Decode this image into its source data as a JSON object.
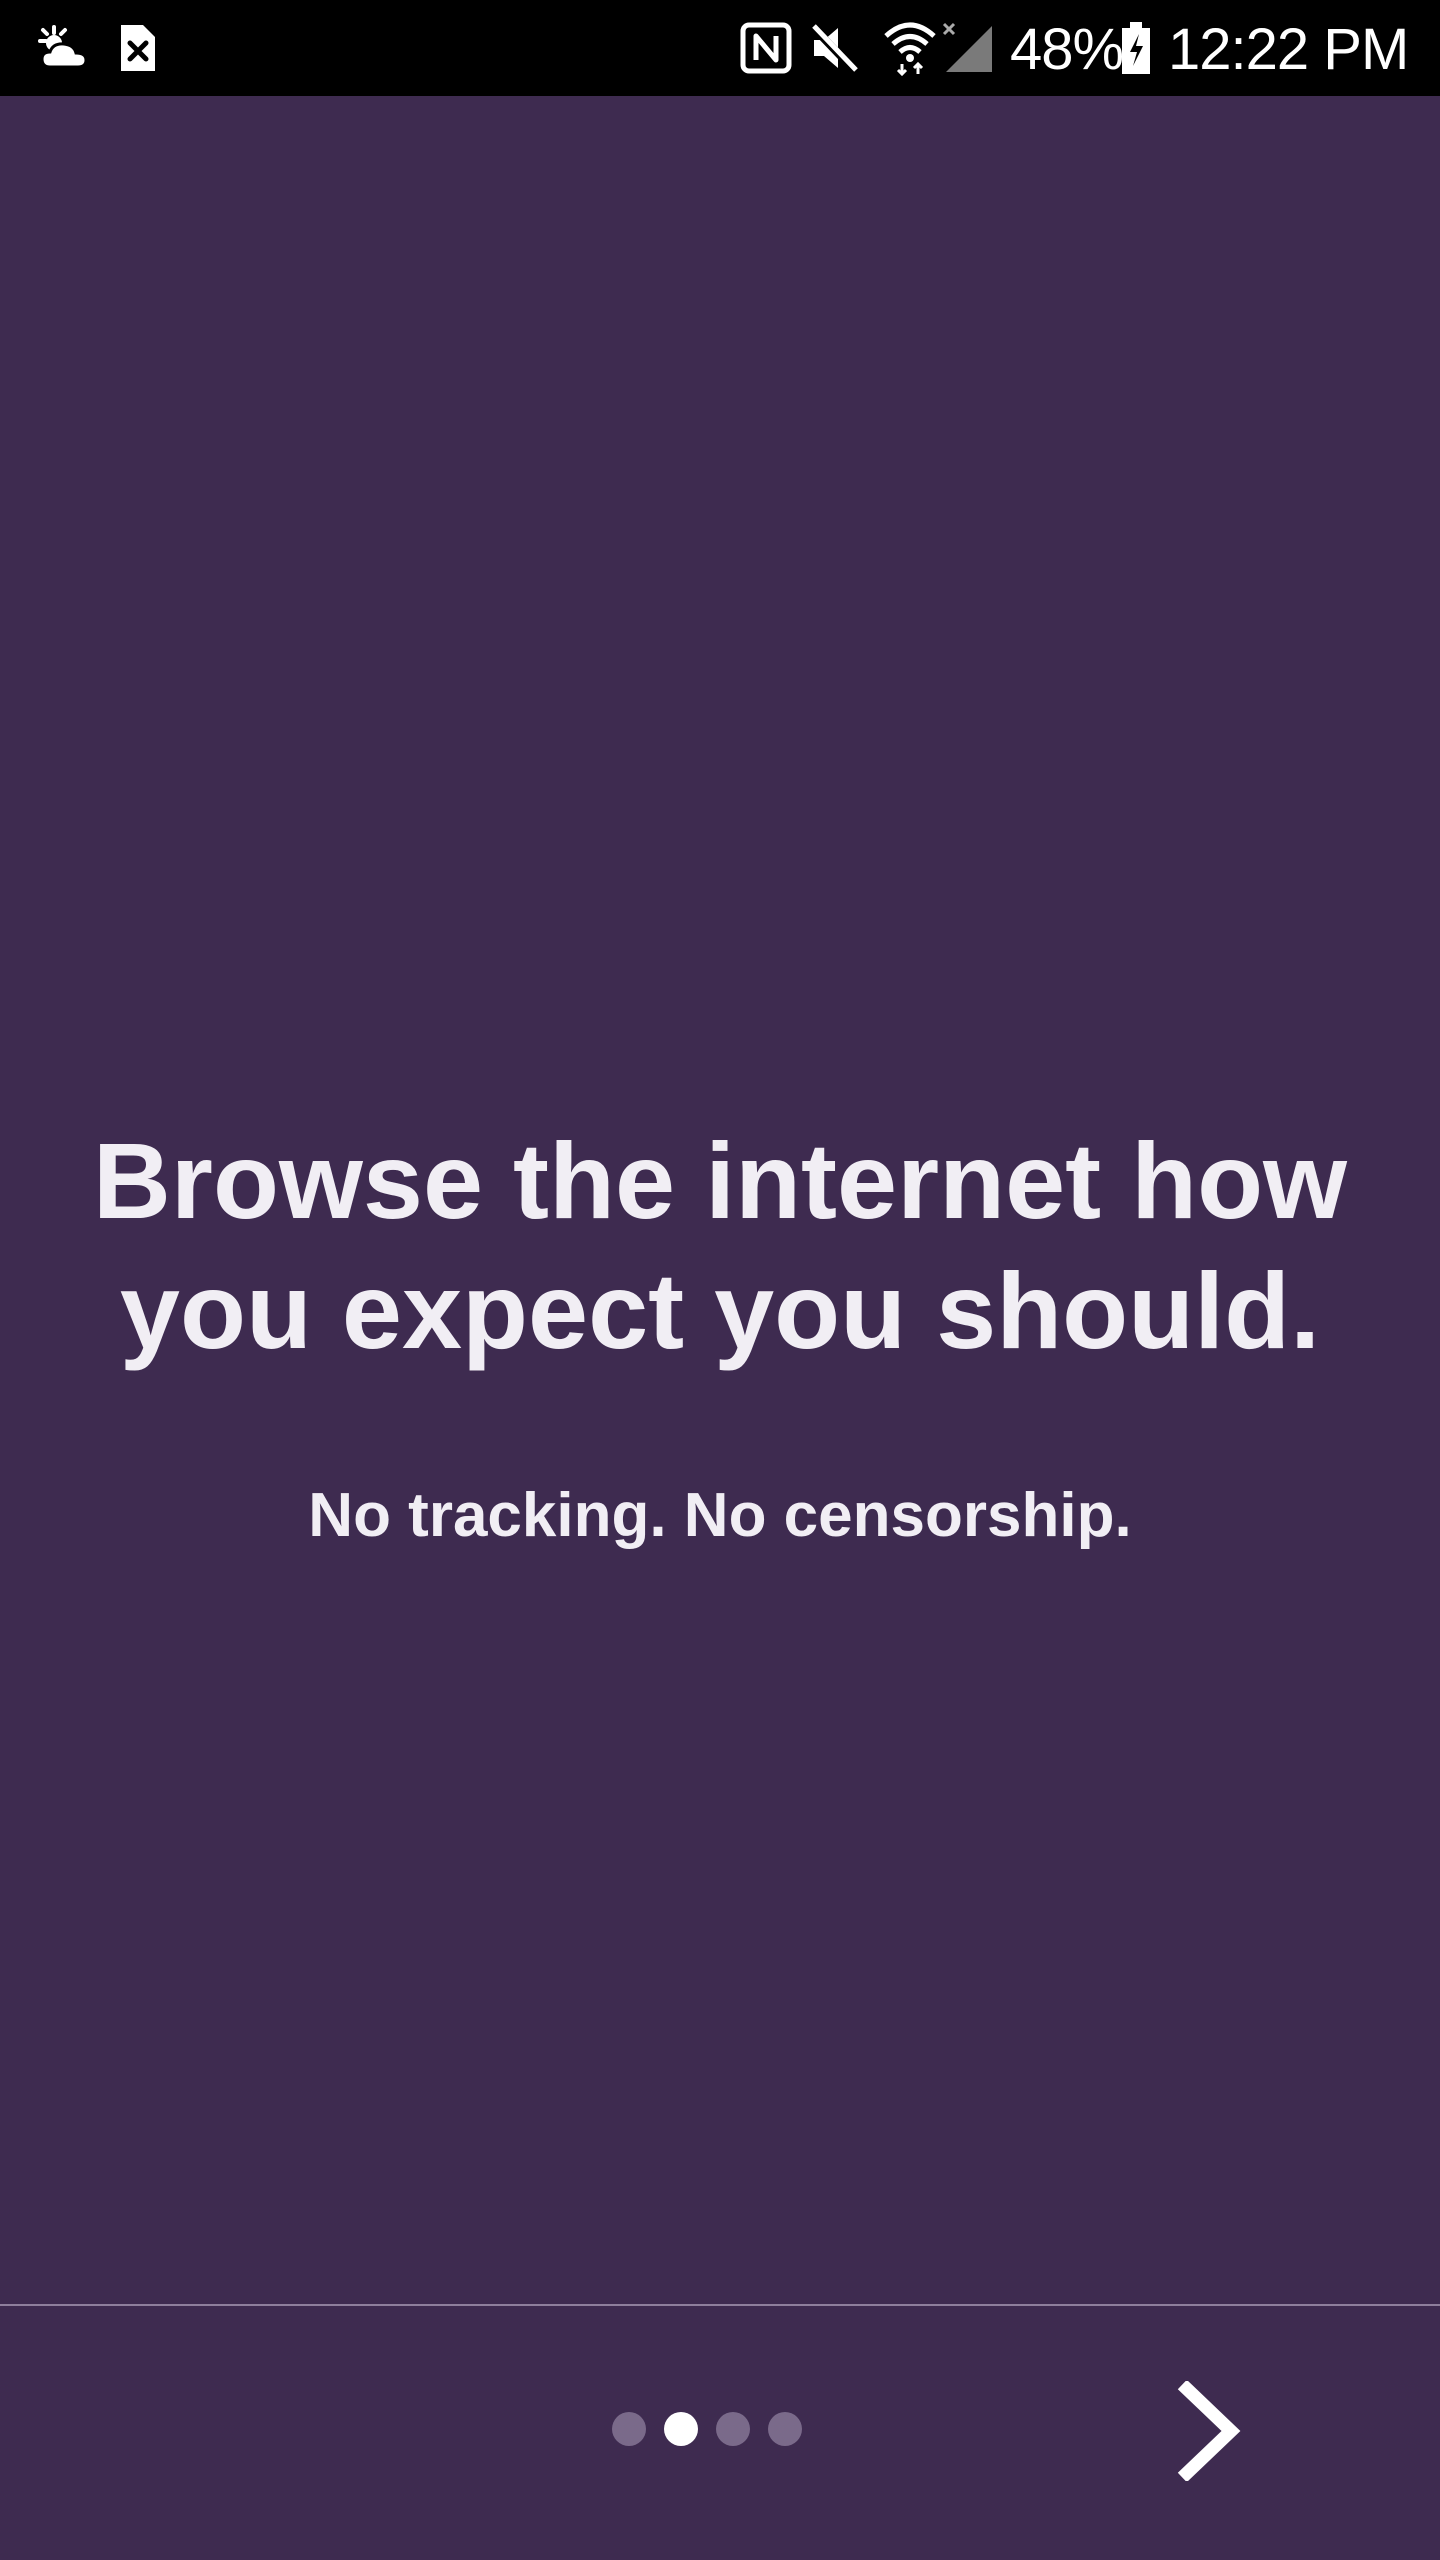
{
  "status_bar": {
    "icons_left": [
      "weather-partly-cloudy-icon",
      "sim-card-error-icon"
    ],
    "icons_right": [
      "nfc-icon",
      "mute-icon",
      "wifi-icon",
      "cellular-no-signal-icon",
      "battery-charging-icon"
    ],
    "battery_percent": "48%",
    "time": "12:22 PM"
  },
  "onboarding": {
    "headline_line1": "Browse the internet how",
    "headline_line2": "you expect you should.",
    "subtitle": "No tracking. No censorship.",
    "page_indicator": {
      "total": 4,
      "active_index": 1
    },
    "next_icon": "chevron-right-icon"
  },
  "colors": {
    "background": "#3e2b50",
    "status_bar": "#000000",
    "text": "#f1eef4",
    "dot_inactive": "#7a6a8a",
    "dot_active": "#ffffff"
  }
}
